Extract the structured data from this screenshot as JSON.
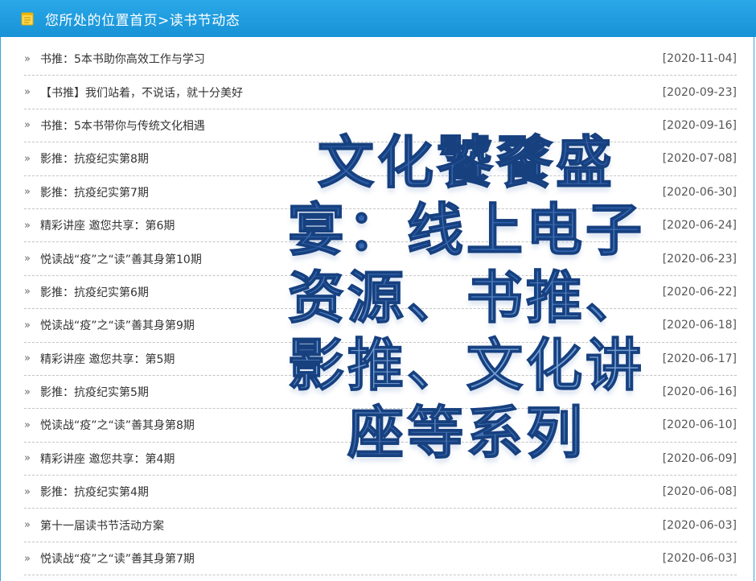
{
  "header": {
    "title": "您所处的位置首页>读书节动态",
    "icon": "notebook-icon"
  },
  "news": [
    {
      "title": "书推：5本书助你高效工作与学习",
      "date": "[2020-11-04]"
    },
    {
      "title": "【书推】我们站着，不说话，就十分美好",
      "date": "[2020-09-23]"
    },
    {
      "title": "书推：5本书带你与传统文化相遇",
      "date": "[2020-09-16]"
    },
    {
      "title": "影推：抗疫纪实第8期",
      "date": "[2020-07-08]"
    },
    {
      "title": "影推：抗疫纪实第7期",
      "date": "[2020-06-30]"
    },
    {
      "title": "精彩讲座 邀您共享：第6期",
      "date": "[2020-06-24]"
    },
    {
      "title": "悦读战“疫”之“读”善其身第10期",
      "date": "[2020-06-23]"
    },
    {
      "title": "影推：抗疫纪实第6期",
      "date": "[2020-06-22]"
    },
    {
      "title": "悦读战“疫”之“读”善其身第9期",
      "date": "[2020-06-18]"
    },
    {
      "title": "精彩讲座 邀您共享：第5期",
      "date": "[2020-06-17]"
    },
    {
      "title": "影推：抗疫纪实第5期",
      "date": "[2020-06-16]"
    },
    {
      "title": "悦读战“疫”之“读”善其身第8期",
      "date": "[2020-06-10]"
    },
    {
      "title": "精彩讲座 邀您共享：第4期",
      "date": "[2020-06-09]"
    },
    {
      "title": "影推：抗疫纪实第4期",
      "date": "[2020-06-08]"
    },
    {
      "title": "第十一届读书节活动方案",
      "date": "[2020-06-03]"
    },
    {
      "title": "悦读战“疫”之“读”善其身第7期",
      "date": "[2020-06-03]"
    }
  ],
  "overlay": {
    "text": "文化饕餮盛宴：线上电子资源、书推、影推、文化讲座等系列"
  },
  "arrow_glyph": "»",
  "colors": {
    "header_bg": "#1e9fe0",
    "overlay_text": "#2f67b8"
  }
}
